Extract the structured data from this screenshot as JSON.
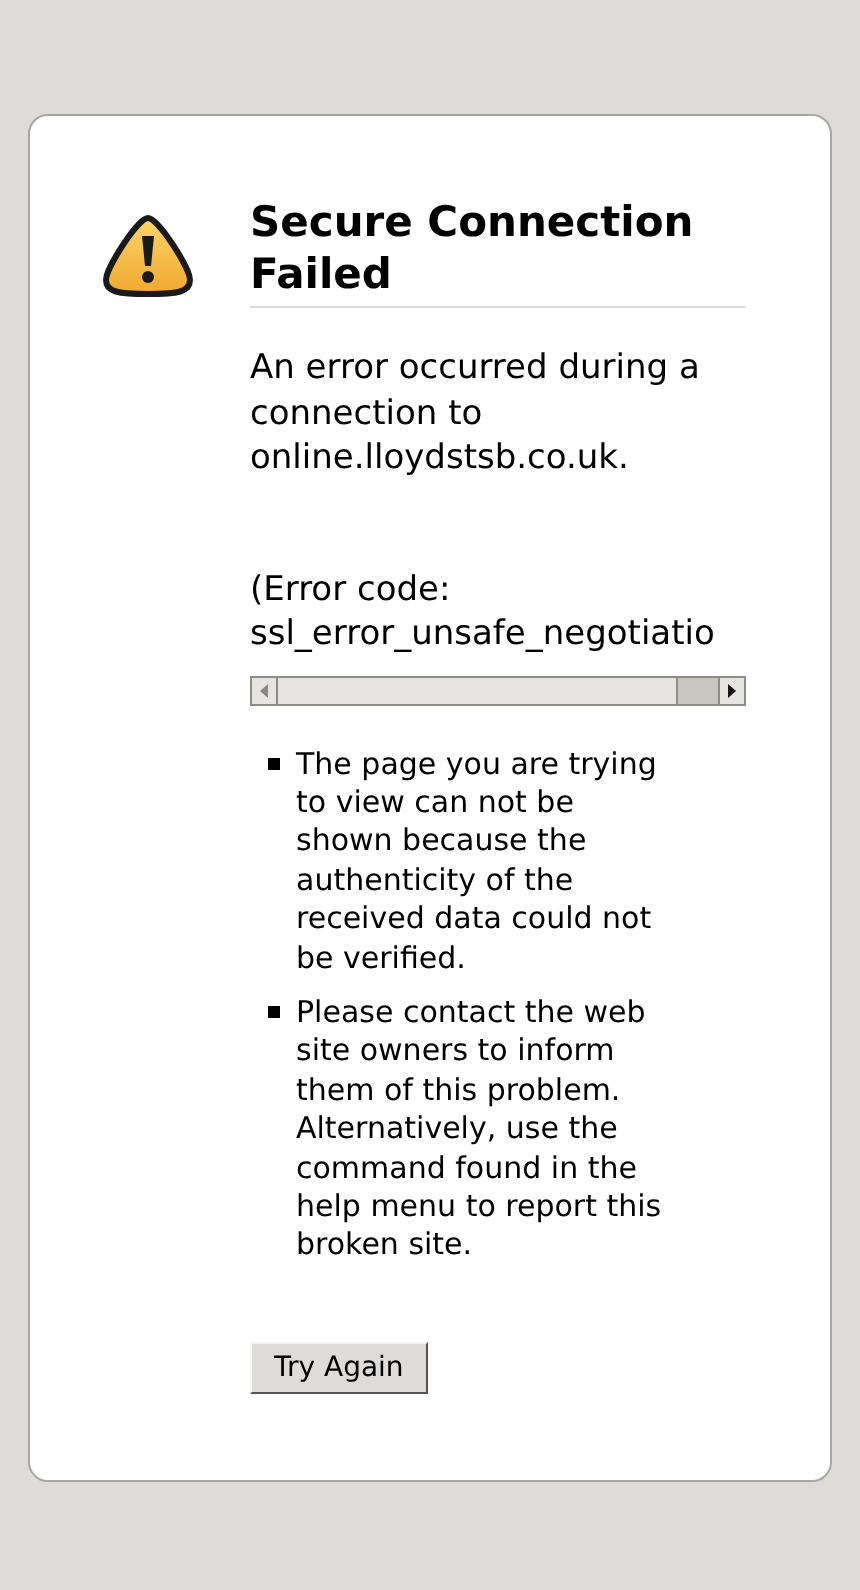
{
  "title": "Secure Connection Failed",
  "message": "An error occurred during a connection to online.lloydstsb.co.uk.",
  "error_code": {
    "label": "(Error code:",
    "value": "ssl_error_unsafe_negotiatio"
  },
  "reasons": [
    "The page you are trying to view can not be shown because the authenticity of the received data could not be verified.",
    "Please contact the web site owners to inform them of this problem. Alternatively, use the command found in the help menu to report this broken site."
  ],
  "button": "Try Again"
}
